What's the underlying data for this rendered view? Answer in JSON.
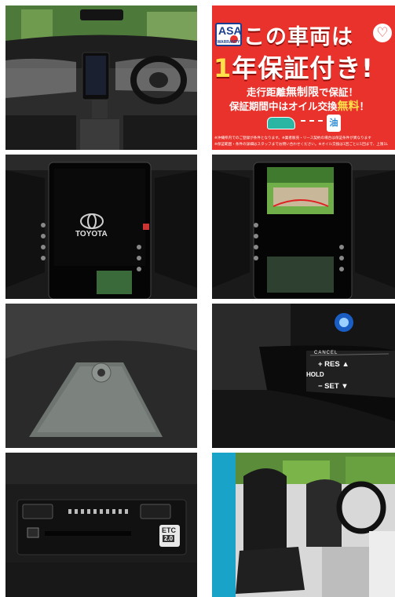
{
  "gallery": {
    "photos": [
      {
        "id": "interior-dashboard",
        "icon": "car-interior"
      },
      {
        "id": "warranty-banner",
        "icon": "banner"
      },
      {
        "id": "center-display-logo",
        "icon": "display"
      },
      {
        "id": "center-display-camera",
        "icon": "display"
      },
      {
        "id": "windshield-sensor",
        "icon": "sensor"
      },
      {
        "id": "cruise-control-stalk",
        "icon": "stalk"
      },
      {
        "id": "etc-unit",
        "icon": "etc"
      },
      {
        "id": "front-seats",
        "icon": "seat"
      }
    ]
  },
  "promo": {
    "logo_text": "ASA",
    "logo_sub": "WARRANTY",
    "headline_1": "この車両は",
    "heart": "♡",
    "headline_2_num": "1",
    "headline_2_rest": "年保証付き!",
    "line1_pre": "走行距離",
    "line1_em": "無制限",
    "line1_post": "で保証！",
    "line2_pre": "保証期間中は",
    "line2_mid": "オイル交換",
    "line2_em": "無料",
    "line2_post": "！",
    "oil_icon": "油",
    "fine_1": "※沖縄県内でのご登録が条件となります。※業者販売・リース契約の場合は保証条件が異なります",
    "fine_2": "※保証範囲・条件の詳細はスタッフまでお問い合わせください。※オイル交換は1回ごとに1回まで、上限1L"
  },
  "display_brand": "TOYOTA",
  "stalk_labels": {
    "cancel": "CANCEL",
    "res": "+ RES ▲",
    "hold": "HOLD",
    "set": "− SET ▼"
  },
  "etc_badge": {
    "top": "ETC",
    "bottom": "2.0"
  },
  "colors": {
    "promo_red": "#e8322b",
    "brand_blue": "#1b3d8f",
    "highlight_yellow": "#ffe14a",
    "car_body_teal": "#2bb5a3"
  }
}
